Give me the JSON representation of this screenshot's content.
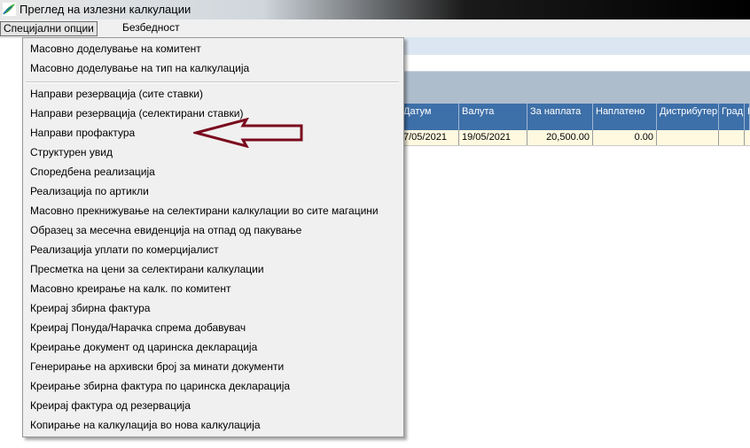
{
  "window": {
    "title": "Преглед на излезни калкулации"
  },
  "menubar": {
    "items": [
      "Специјални опции",
      "Безбедност"
    ]
  },
  "grid": {
    "columns": [
      "Датум",
      "Валута",
      "За наплата",
      "Наплатено",
      "Дистрибутер",
      "Град",
      "К"
    ],
    "row": [
      "7/05/2021",
      "19/05/2021",
      "20,500.00",
      "0.00",
      "",
      "",
      ""
    ]
  },
  "dropdown": {
    "items": [
      "Масовно доделување на комитент",
      "Масовно доделување  на тип на калкулација",
      "Направи резервација (сите ставки)",
      "Направи резервација (селектирани ставки)",
      "Направи профактура",
      "Структурен увид",
      "Споредбена реализација",
      "Реализација по артикли",
      "Масовно прекнижување на селектирани калкулации во сите магацини",
      "Образец за месечна евиденција на отпад од пакување",
      "Реализација уплати по комерцијалист",
      "Пресметка на цени за селектирани калкулации",
      "Масовно креирање на калк. по комитент",
      "Креирај збирна фактура",
      "Креирај Понуда/Нарачка спрема добавувач",
      "Креирање документ од царинска декларација",
      "Генерирање на архивски број за минати документи",
      "Креирање збирна фактура по царинска декларација",
      "Креирај фактура од резервација",
      "Копирање на калкулација во нова калкулација"
    ]
  },
  "colors": {
    "header_blue": "#3d6fa8",
    "row_yellow": "#fff9e0",
    "arrow": "#7a0a1e"
  },
  "icons": {
    "app": "leaf-logo-icon",
    "annotation": "left-arrow-annotation-icon"
  }
}
